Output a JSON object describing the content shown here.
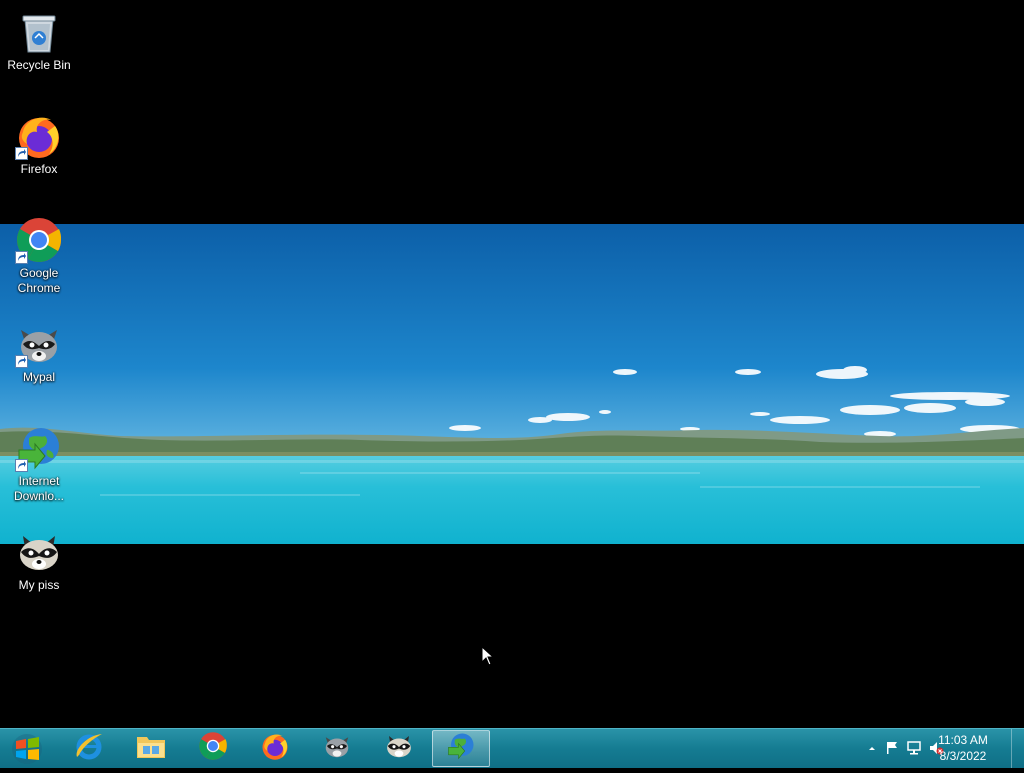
{
  "desktop": {
    "icons": [
      {
        "label": "Recycle Bin",
        "icon": "recycle-bin-icon"
      },
      {
        "label": "Firefox",
        "icon": "firefox-icon"
      },
      {
        "label": "Google Chrome",
        "icon": "chrome-icon"
      },
      {
        "label": "Mypal",
        "icon": "raccoon-icon"
      },
      {
        "label": "Internet Downlo...",
        "icon": "internet-download-manager-icon"
      },
      {
        "label": "My piss",
        "icon": "raccoon-icon"
      }
    ]
  },
  "taskbar": {
    "pinned": [
      {
        "icon": "internet-explorer-icon",
        "active": false
      },
      {
        "icon": "file-explorer-icon",
        "active": false
      },
      {
        "icon": "chrome-icon",
        "active": false
      },
      {
        "icon": "firefox-icon",
        "active": false
      },
      {
        "icon": "raccoon-icon",
        "active": false
      },
      {
        "icon": "raccoon-icon",
        "active": false
      },
      {
        "icon": "internet-download-manager-icon",
        "active": true
      }
    ],
    "tray": {
      "icons": [
        "show-hidden-icons-arrow",
        "action-center-flag-icon",
        "network-icon",
        "volume-muted-icon"
      ],
      "time": "11:03 AM",
      "date": "8/3/2022"
    }
  },
  "colors": {
    "taskbar": "#157c92",
    "sky": "#1c7fc4",
    "lake": "#1fc3dc"
  }
}
